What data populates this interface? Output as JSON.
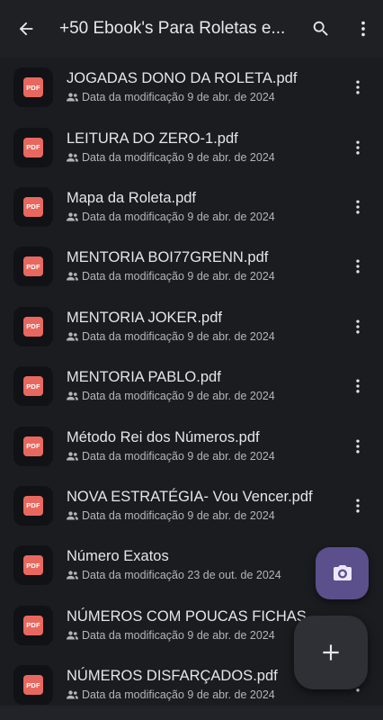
{
  "topbar": {
    "title": "+50 Ebook's Para Roletas e...",
    "back_icon": "arrow-left-icon",
    "search_icon": "search-icon",
    "more_icon": "more-vert-icon"
  },
  "files": [
    {
      "name": "JOGADAS DONO DA ROLETA.pdf",
      "meta": "Data da modificação 9 de abr. de 2024",
      "badge": "PDF"
    },
    {
      "name": "LEITURA DO ZERO-1.pdf",
      "meta": "Data da modificação 9 de abr. de 2024",
      "badge": "PDF"
    },
    {
      "name": "Mapa da Roleta.pdf",
      "meta": "Data da modificação 9 de abr. de 2024",
      "badge": "PDF"
    },
    {
      "name": "MENTORIA BOI77GRENN.pdf",
      "meta": "Data da modificação 9 de abr. de 2024",
      "badge": "PDF"
    },
    {
      "name": "MENTORIA JOKER.pdf",
      "meta": "Data da modificação 9 de abr. de 2024",
      "badge": "PDF"
    },
    {
      "name": "MENTORIA PABLO.pdf",
      "meta": "Data da modificação 9 de abr. de 2024",
      "badge": "PDF"
    },
    {
      "name": "Método Rei dos Números.pdf",
      "meta": "Data da modificação 9 de abr. de 2024",
      "badge": "PDF"
    },
    {
      "name": "NOVA ESTRATÉGIA- Vou Vencer.pdf",
      "meta": "Data da modificação 9 de abr. de 2024",
      "badge": "PDF"
    },
    {
      "name": "Número Exatos",
      "meta": "Data da modificação 23 de out. de 2024",
      "badge": "PDF"
    },
    {
      "name": "NÚMEROS COM POUCAS FICHAS",
      "meta": "Data da modificação 9 de abr. de 2024",
      "badge": "PDF"
    },
    {
      "name": "NÚMEROS DISFARÇADOS.pdf",
      "meta": "Data da modificação 9 de abr. de 2024",
      "badge": "PDF"
    }
  ],
  "fabs": {
    "camera_icon": "camera-icon",
    "add_icon": "plus-icon",
    "camera_color": "#5b4f8c",
    "add_color": "#2e3036"
  },
  "colors": {
    "background": "#1b1c20",
    "pdf_red": "#e8685f"
  }
}
